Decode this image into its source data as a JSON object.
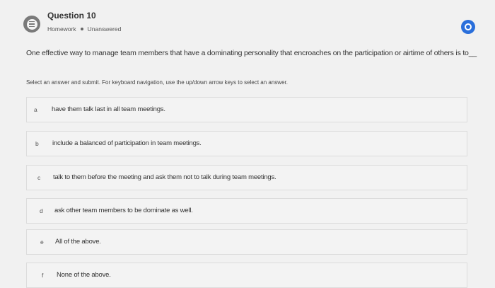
{
  "header": {
    "title": "Question 10",
    "type": "Homework",
    "status": "Unanswered",
    "icon": "question-list-icon",
    "info_icon": "info-icon",
    "accent": "#2a6fdb"
  },
  "question": {
    "text": "One effective way to manage team members that have a dominating personality that encroaches on the participation or airtime of others is to__"
  },
  "instructions": "Select an answer and submit. For keyboard navigation, use the up/down arrow keys to select an answer.",
  "options": [
    {
      "letter": "a",
      "text": "have them talk last in all team meetings."
    },
    {
      "letter": "b",
      "text": "include a balanced of participation in team meetings."
    },
    {
      "letter": "c",
      "text": "talk to them before the meeting and ask them not to talk during team meetings."
    },
    {
      "letter": "d",
      "text": "ask other team members to be dominate as well."
    },
    {
      "letter": "e",
      "text": "All of the above."
    },
    {
      "letter": "f",
      "text": "None of the above."
    }
  ]
}
